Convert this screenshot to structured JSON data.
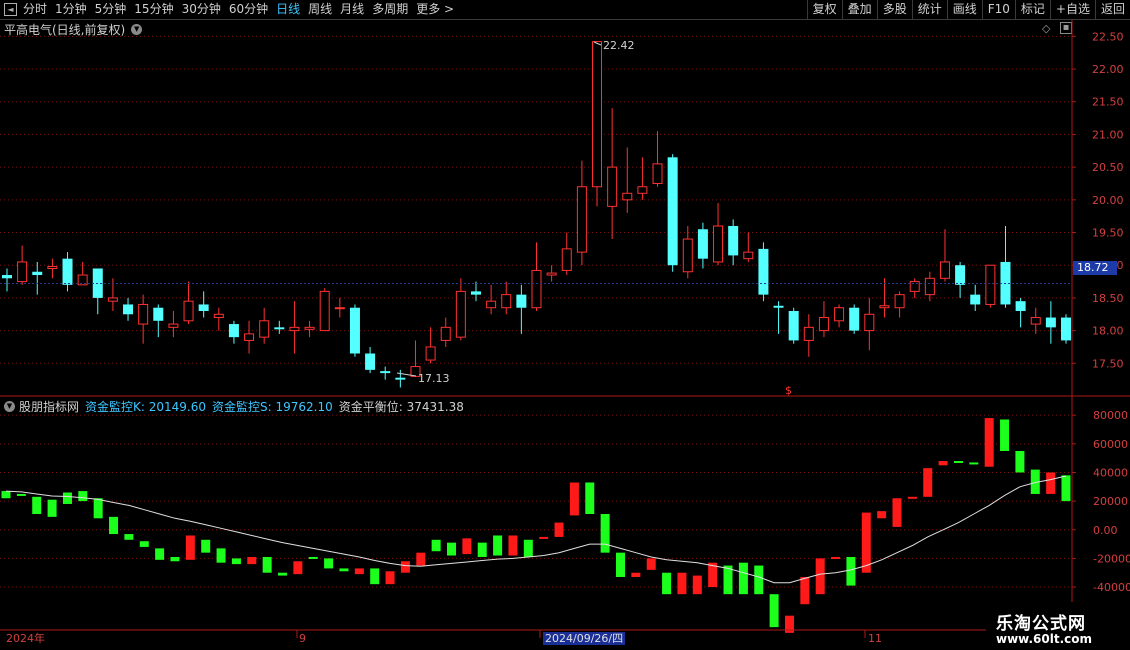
{
  "toolbar": {
    "left_items": [
      "分时",
      "1分钟",
      "5分钟",
      "15分钟",
      "30分钟",
      "60分钟",
      "日线",
      "周线",
      "月线",
      "多周期",
      "更多 >"
    ],
    "active_index": 6,
    "right_items": [
      "复权",
      "叠加",
      "多股",
      "统计",
      "画线",
      "F10",
      "标记",
      "+自选",
      "返回"
    ]
  },
  "main": {
    "title": "平高电气(日线,前复权)",
    "current_price": "18.72",
    "high_label": "22.42",
    "low_label": "17.13",
    "marker": "$",
    "y_ticks": [
      "22.50",
      "22.00",
      "21.50",
      "21.00",
      "20.50",
      "20.00",
      "19.50",
      "19.00",
      "18.50",
      "18.00",
      "17.50"
    ]
  },
  "indicator": {
    "name": "股朋指标网",
    "k_label": "资金監控K: 20149.60",
    "s_label": "资金監控S: 19762.10",
    "balance_label": "资金平衡位: 37431.38",
    "y_ticks": [
      "80000",
      "60000",
      "40000",
      "20000",
      "0.00",
      "-20000",
      "-40000"
    ]
  },
  "xaxis": {
    "labels": [
      "2024年",
      "9",
      "2024/09/26/四",
      "11"
    ]
  },
  "watermark": {
    "line1": "乐淘公式网",
    "line2": "www.60lt.com"
  },
  "colors": {
    "up": "#ff3232",
    "down": "#54ffff",
    "ind_up": "#ff1a1a",
    "ind_down": "#1cff1c",
    "grid": "#7a1010",
    "axis": "#b01818",
    "ma": "#e0e0e0",
    "active": "#3ec6ff"
  },
  "chart_data": [
    {
      "type": "candlestick",
      "title": "平高电气(日线,前复权)",
      "ylim": [
        17.1,
        22.6
      ],
      "high": 22.42,
      "low": 17.13,
      "candles": [
        [
          18.85,
          18.8,
          18.95,
          18.6
        ],
        [
          18.75,
          19.05,
          19.3,
          18.7
        ],
        [
          18.9,
          18.85,
          19.05,
          18.55
        ],
        [
          18.95,
          18.98,
          19.1,
          18.8
        ],
        [
          19.1,
          18.7,
          19.2,
          18.6
        ],
        [
          18.7,
          18.85,
          19.05,
          18.7
        ],
        [
          18.95,
          18.5,
          18.95,
          18.25
        ],
        [
          18.45,
          18.5,
          18.8,
          18.3
        ],
        [
          18.4,
          18.25,
          18.5,
          18.15
        ],
        [
          18.1,
          18.4,
          18.55,
          17.8
        ],
        [
          18.35,
          18.15,
          18.4,
          17.9
        ],
        [
          18.05,
          18.1,
          18.3,
          17.9
        ],
        [
          18.15,
          18.45,
          18.75,
          18.1
        ],
        [
          18.4,
          18.3,
          18.6,
          18.2
        ],
        [
          18.2,
          18.25,
          18.35,
          18.0
        ],
        [
          18.1,
          17.9,
          18.15,
          17.8
        ],
        [
          17.85,
          17.95,
          18.15,
          17.65
        ],
        [
          17.9,
          18.15,
          18.35,
          17.8
        ],
        [
          18.05,
          18.02,
          18.15,
          17.95
        ],
        [
          18.0,
          18.05,
          18.45,
          17.65
        ],
        [
          18.02,
          18.05,
          18.15,
          17.9
        ],
        [
          18.0,
          18.6,
          18.65,
          18.0
        ],
        [
          18.35,
          18.35,
          18.5,
          18.2
        ],
        [
          18.35,
          17.65,
          18.4,
          17.6
        ],
        [
          17.65,
          17.4,
          17.75,
          17.35
        ],
        [
          17.38,
          17.35,
          17.45,
          17.25
        ],
        [
          17.28,
          17.25,
          17.4,
          17.13
        ],
        [
          17.3,
          17.45,
          17.85,
          17.3
        ],
        [
          17.55,
          17.75,
          18.05,
          17.5
        ],
        [
          17.85,
          18.05,
          18.2,
          17.75
        ],
        [
          17.9,
          18.6,
          18.8,
          17.85
        ],
        [
          18.6,
          18.55,
          18.75,
          18.45
        ],
        [
          18.35,
          18.45,
          18.7,
          18.25
        ],
        [
          18.35,
          18.55,
          18.75,
          18.25
        ],
        [
          18.55,
          18.35,
          18.7,
          17.95
        ],
        [
          18.35,
          18.92,
          19.35,
          18.3
        ],
        [
          18.85,
          18.88,
          19.0,
          18.75
        ],
        [
          18.92,
          19.25,
          19.5,
          18.85
        ],
        [
          19.2,
          20.2,
          20.6,
          19.0
        ],
        [
          20.2,
          22.42,
          22.42,
          19.9
        ],
        [
          19.9,
          20.5,
          21.4,
          19.4
        ],
        [
          20.0,
          20.1,
          20.8,
          19.8
        ],
        [
          20.1,
          20.2,
          20.65,
          20.0
        ],
        [
          20.25,
          20.55,
          21.05,
          20.2
        ],
        [
          20.65,
          19.0,
          20.7,
          18.9
        ],
        [
          18.9,
          19.4,
          19.6,
          18.8
        ],
        [
          19.55,
          19.1,
          19.65,
          18.95
        ],
        [
          19.05,
          19.6,
          19.95,
          19.0
        ],
        [
          19.6,
          19.15,
          19.7,
          19.0
        ],
        [
          19.1,
          19.2,
          19.5,
          19.05
        ],
        [
          19.25,
          18.55,
          19.35,
          18.45
        ],
        [
          18.38,
          18.35,
          18.45,
          17.95
        ],
        [
          18.3,
          17.85,
          18.35,
          17.8
        ],
        [
          17.85,
          18.05,
          18.25,
          17.6
        ],
        [
          18.0,
          18.2,
          18.45,
          17.9
        ],
        [
          18.15,
          18.35,
          18.4,
          18.05
        ],
        [
          18.35,
          18.0,
          18.4,
          17.95
        ],
        [
          18.0,
          18.25,
          18.5,
          17.7
        ],
        [
          18.35,
          18.38,
          18.8,
          18.2
        ],
        [
          18.35,
          18.55,
          18.6,
          18.2
        ],
        [
          18.6,
          18.75,
          18.8,
          18.5
        ],
        [
          18.55,
          18.8,
          18.9,
          18.45
        ],
        [
          18.8,
          19.05,
          19.55,
          18.75
        ],
        [
          19.0,
          18.7,
          19.05,
          18.5
        ],
        [
          18.55,
          18.4,
          18.7,
          18.3
        ],
        [
          18.4,
          19.0,
          19.0,
          18.35
        ],
        [
          19.05,
          18.4,
          19.6,
          18.35
        ],
        [
          18.45,
          18.3,
          18.5,
          18.05
        ],
        [
          18.1,
          18.2,
          18.35,
          17.95
        ],
        [
          18.2,
          18.05,
          18.45,
          17.8
        ],
        [
          18.2,
          17.85,
          18.25,
          17.8
        ]
      ]
    },
    {
      "type": "bar",
      "title": "股朋指标网",
      "ylim": [
        -62000,
        82000
      ],
      "k": 20149.6,
      "s": 19762.1,
      "balance": 37431.38,
      "bars": [
        [
          27000,
          22000
        ],
        [
          25000,
          24000
        ],
        [
          23000,
          11000
        ],
        [
          21000,
          9000
        ],
        [
          26000,
          18000
        ],
        [
          27000,
          20000
        ],
        [
          22000,
          8000
        ],
        [
          9000,
          -3000
        ],
        [
          -3000,
          -7000
        ],
        [
          -8000,
          -12000
        ],
        [
          -13000,
          -21000
        ],
        [
          -19000,
          -22000
        ],
        [
          -21000,
          -4000
        ],
        [
          -7000,
          -16000
        ],
        [
          -13000,
          -23000
        ],
        [
          -20000,
          -24000
        ],
        [
          -24000,
          -19000
        ],
        [
          -19000,
          -30000
        ],
        [
          -30000,
          -32000
        ],
        [
          -31000,
          -22000
        ],
        [
          -19000,
          -20000
        ],
        [
          -20000,
          -27000
        ],
        [
          -27000,
          -29000
        ],
        [
          -31000,
          -27000
        ],
        [
          -27000,
          -38000
        ],
        [
          -38000,
          -29000
        ],
        [
          -30000,
          -22000
        ],
        [
          -25000,
          -16000
        ],
        [
          -7000,
          -15000
        ],
        [
          -9000,
          -18000
        ],
        [
          -17000,
          -6000
        ],
        [
          -9000,
          -19000
        ],
        [
          -4000,
          -18000
        ],
        [
          -18000,
          -4000
        ],
        [
          -7000,
          -19000
        ],
        [
          -6000,
          -5000
        ],
        [
          -5000,
          5000
        ],
        [
          10000,
          33000
        ],
        [
          33000,
          11000
        ],
        [
          11000,
          -16000
        ],
        [
          -16000,
          -33000
        ],
        [
          -33000,
          -30000
        ],
        [
          -28000,
          -20000
        ],
        [
          -30000,
          -45000
        ],
        [
          -45000,
          -30000
        ],
        [
          -45000,
          -32000
        ],
        [
          -40000,
          -23000
        ],
        [
          -25000,
          -45000
        ],
        [
          -23000,
          -45000
        ],
        [
          -25000,
          -45000
        ],
        [
          -45000,
          -68000
        ],
        [
          -72000,
          -60000
        ],
        [
          -52000,
          -33000
        ],
        [
          -45000,
          -20000
        ],
        [
          -20000,
          -19000
        ],
        [
          -19000,
          -39000
        ],
        [
          -30000,
          12000
        ],
        [
          8000,
          13000
        ],
        [
          2000,
          22000
        ],
        [
          22000,
          23000
        ],
        [
          23000,
          43000
        ],
        [
          45000,
          48000
        ],
        [
          48000,
          47000
        ],
        [
          47000,
          46000
        ],
        [
          44000,
          78000
        ],
        [
          77000,
          55000
        ],
        [
          55000,
          40000
        ],
        [
          42000,
          25000
        ],
        [
          25000,
          40000
        ],
        [
          38000,
          20000
        ]
      ],
      "ma": [
        27000,
        26400,
        25000,
        23600,
        23200,
        22400,
        21200,
        19000,
        17000,
        14000,
        11000,
        8000,
        6000,
        3500,
        1000,
        -1500,
        -4000,
        -6500,
        -9000,
        -11000,
        -13000,
        -15000,
        -17000,
        -19000,
        -21500,
        -23500,
        -25000,
        -25500,
        -24500,
        -23500,
        -22500,
        -21500,
        -20500,
        -20000,
        -19000,
        -18000,
        -16000,
        -13000,
        -10000,
        -10000,
        -13000,
        -16000,
        -19000,
        -21000,
        -22000,
        -23000,
        -25000,
        -27000,
        -30000,
        -33000,
        -37000,
        -37000,
        -34000,
        -31000,
        -30000,
        -28000,
        -25000,
        -21000,
        -16000,
        -11000,
        -5000,
        0,
        5000,
        11000,
        17000,
        24000,
        30000,
        33000,
        35000,
        37500
      ]
    }
  ]
}
